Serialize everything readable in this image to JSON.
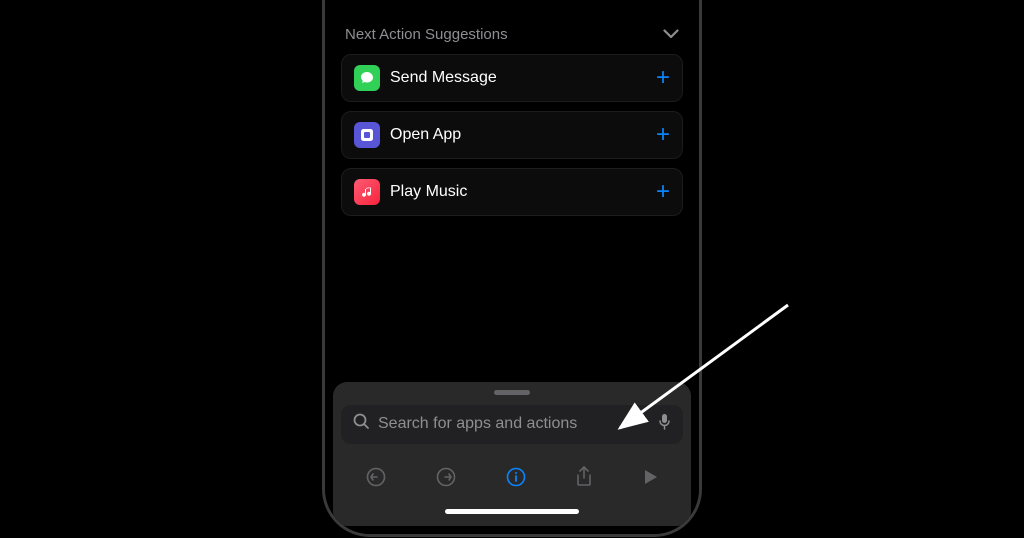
{
  "section": {
    "title": "Next Action Suggestions"
  },
  "actions": [
    {
      "label": "Send Message",
      "icon": "message-icon",
      "color": "green"
    },
    {
      "label": "Open App",
      "icon": "app-icon",
      "color": "purple"
    },
    {
      "label": "Play Music",
      "icon": "music-icon",
      "color": "red"
    }
  ],
  "search": {
    "placeholder": "Search for apps and actions"
  },
  "colors": {
    "accent": "#0a84ff",
    "muted": "#8e8e93"
  }
}
